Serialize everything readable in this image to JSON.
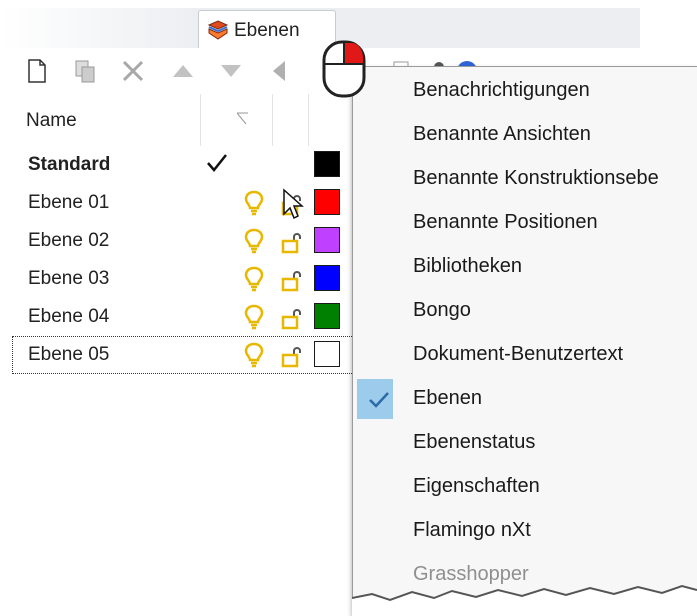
{
  "tab": {
    "label": "Ebenen"
  },
  "toolbar": {
    "icons": [
      "new-layer-icon",
      "new-sublayer-icon",
      "delete-icon",
      "move-up-icon",
      "move-down-icon",
      "move-left-icon",
      "filter-icon",
      "copy-icon",
      "tools-icon",
      "help-icon"
    ]
  },
  "table": {
    "column_name": "Name",
    "rows": [
      {
        "name": "Standard",
        "current": true,
        "color": "#000000",
        "visible": null,
        "locked": null
      },
      {
        "name": "Ebene 01",
        "current": false,
        "color": "#ff0000",
        "visible": true,
        "locked": false
      },
      {
        "name": "Ebene 02",
        "current": false,
        "color": "#bf40ff",
        "visible": true,
        "locked": false
      },
      {
        "name": "Ebene 03",
        "current": false,
        "color": "#0000ff",
        "visible": true,
        "locked": false
      },
      {
        "name": "Ebene 04",
        "current": false,
        "color": "#008000",
        "visible": true,
        "locked": false
      },
      {
        "name": "Ebene 05",
        "current": false,
        "color": "#ffffff",
        "visible": true,
        "locked": false
      }
    ]
  },
  "menu": {
    "items": [
      {
        "label": "Benachrichtigungen",
        "checked": false,
        "enabled": true
      },
      {
        "label": "Benannte Ansichten",
        "checked": false,
        "enabled": true
      },
      {
        "label": "Benannte Konstruktionsebe",
        "checked": false,
        "enabled": true
      },
      {
        "label": "Benannte Positionen",
        "checked": false,
        "enabled": true
      },
      {
        "label": "Bibliotheken",
        "checked": false,
        "enabled": true
      },
      {
        "label": "Bongo",
        "checked": false,
        "enabled": true
      },
      {
        "label": "Dokument-Benutzertext",
        "checked": false,
        "enabled": true
      },
      {
        "label": "Ebenen",
        "checked": true,
        "enabled": true
      },
      {
        "label": "Ebenenstatus",
        "checked": false,
        "enabled": true
      },
      {
        "label": "Eigenschaften",
        "checked": false,
        "enabled": true
      },
      {
        "label": "Flamingo nXt",
        "checked": false,
        "enabled": true
      },
      {
        "label": "Grasshopper",
        "checked": false,
        "enabled": false
      }
    ]
  },
  "colors": {
    "menu_check_highlight": "#9ccbeb",
    "bulb": "#e8b800",
    "lock": "#e8b800"
  }
}
